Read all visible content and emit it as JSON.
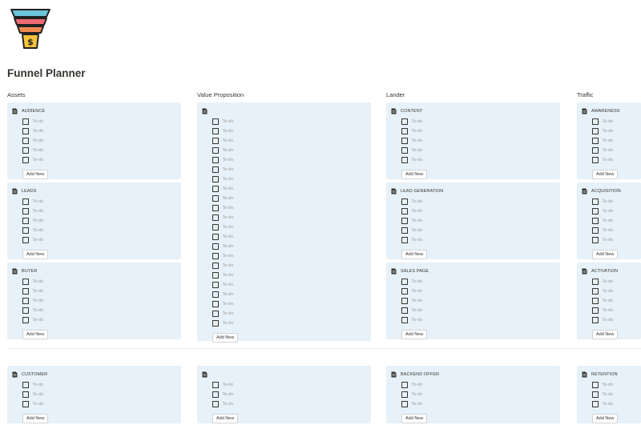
{
  "page": {
    "title": "Funnel Planner"
  },
  "icons": {
    "logo": "funnel-dollar-icon",
    "card": "page-icon",
    "todo": "checkbox-icon"
  },
  "colors": {
    "card_bg": "#e7f1f9",
    "funnel_top": "#6cc4d6",
    "funnel_mid1": "#ee6b73",
    "funnel_mid2": "#f28b50",
    "funnel_bottom": "#f7c33a"
  },
  "columns": [
    {
      "title": "Assets",
      "top_cards": [
        {
          "title": "AUDIENCE",
          "todos": [
            "To-do",
            "To-do",
            "To-do",
            "To-do",
            "To-do"
          ],
          "add_label": "Add New"
        },
        {
          "title": "LEADS",
          "todos": [
            "To-do",
            "To-do",
            "To-do",
            "To-do",
            "To-do"
          ],
          "add_label": "Add New"
        },
        {
          "title": "BUYER",
          "todos": [
            "To-do",
            "To-do",
            "To-do",
            "To-do",
            "To-do"
          ],
          "add_label": "Add New"
        }
      ],
      "bottom_card": {
        "title": "CUSTOMER",
        "todos": [
          "To-do",
          "To-do",
          "To-do"
        ],
        "add_label": "Add New"
      }
    },
    {
      "title": "Value Proposition",
      "top_cards": [
        {
          "title": "",
          "todos": [
            "To-do",
            "To-do",
            "To-do",
            "To-do",
            "To-do",
            "To-do",
            "To-do",
            "To-do",
            "To-do",
            "To-do",
            "To-do",
            "To-do",
            "To-do",
            "To-do",
            "To-do",
            "To-do",
            "To-do",
            "To-do",
            "To-do",
            "To-do",
            "To-do",
            "To-do"
          ],
          "add_label": "Add New"
        }
      ],
      "bottom_card": {
        "title": "",
        "todos": [
          "To-do",
          "To-do",
          "To-do"
        ],
        "add_label": "Add New"
      }
    },
    {
      "title": "Lander",
      "top_cards": [
        {
          "title": "CONTENT",
          "todos": [
            "To-do",
            "To-do",
            "To-do",
            "To-do",
            "To-do"
          ],
          "add_label": "Add New"
        },
        {
          "title": "LEAD GENERATION",
          "todos": [
            "To-do",
            "To-do",
            "To-do",
            "To-do",
            "To-do"
          ],
          "add_label": "Add New"
        },
        {
          "title": "SALES PAGE",
          "todos": [
            "To-do",
            "To-do",
            "To-do",
            "To-do",
            "To-do"
          ],
          "add_label": "Add New"
        }
      ],
      "bottom_card": {
        "title": "BACKEND OFFER",
        "todos": [
          "To-do",
          "To-do",
          "To-do"
        ],
        "add_label": "Add New"
      }
    },
    {
      "title": "Traffic",
      "top_cards": [
        {
          "title": "AWARENESS",
          "todos": [
            "To-do",
            "To-do",
            "To-do",
            "To-do",
            "To-do"
          ],
          "add_label": "Add New"
        },
        {
          "title": "ACQUISITION",
          "todos": [
            "To-do",
            "To-do",
            "To-do",
            "To-do",
            "To-do"
          ],
          "add_label": "Add New"
        },
        {
          "title": "ACTIVATION",
          "todos": [
            "To-do",
            "To-do",
            "To-do",
            "To-do",
            "To-do"
          ],
          "add_label": "Add New"
        }
      ],
      "bottom_card": {
        "title": "RETENTION",
        "todos": [
          "To-do",
          "To-do",
          "To-do"
        ],
        "add_label": "Add New"
      }
    }
  ]
}
